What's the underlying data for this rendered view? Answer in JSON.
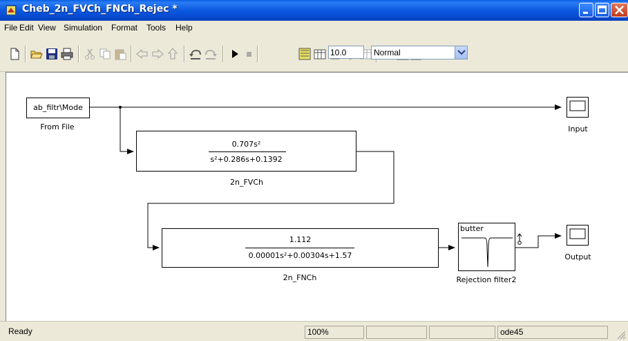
{
  "window": {
    "title": "Cheb_2n_FVCh_FNCh_Rejec *"
  },
  "menu": {
    "items": [
      {
        "label": "File"
      },
      {
        "label": "Edit"
      },
      {
        "label": "View"
      },
      {
        "label": "Simulation"
      },
      {
        "label": "Format"
      },
      {
        "label": "Tools"
      },
      {
        "label": "Help"
      }
    ]
  },
  "toolbar": {
    "stop_time": "10.0",
    "sim_mode": "Normal",
    "icons": [
      "new-icon",
      "open-icon",
      "save-icon",
      "print-icon",
      "cut-icon",
      "copy-icon",
      "paste-icon",
      "back-icon",
      "forward-icon",
      "up-icon",
      "undo-icon",
      "redo-icon",
      "start-simulation-icon",
      "stop-simulation-icon",
      "library-browser-icon",
      "model-explorer-icon",
      "debug-icon",
      "build-icon",
      "incremental-build-icon",
      "run-icon",
      "signal-builder-icon",
      "model-advisor-icon"
    ]
  },
  "diagram": {
    "from_file": {
      "content": "ab_filtr\\Mode",
      "label": "From File"
    },
    "input_scope": {
      "label": "Input"
    },
    "output_scope": {
      "label": "Output"
    },
    "tf1": {
      "numerator": "0.707s²",
      "denominator": "s²+0.286s+0.1392",
      "label": "2n_FVCh"
    },
    "tf2": {
      "numerator": "1.112",
      "denominator": "0.00001s²+0.00304s+1.57",
      "label": "2n_FNCh"
    },
    "filter": {
      "title": "butter",
      "label": "Rejection filter2"
    }
  },
  "status": {
    "state": "Ready",
    "zoom": "100%",
    "panel3": "",
    "panel4": "",
    "solver": "ode45"
  }
}
